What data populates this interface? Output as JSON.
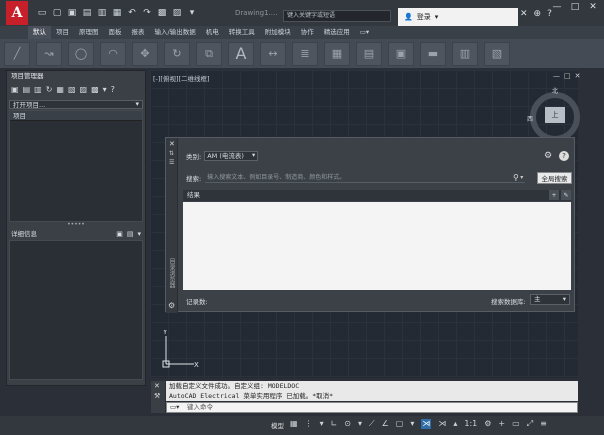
{
  "app": {
    "logo_letter": "A",
    "title": "Drawing1....",
    "search_placeholder": "键入关键字或短语",
    "login_label": "登录",
    "window_controls": [
      "—",
      "□",
      "✕"
    ]
  },
  "ribbon": {
    "tabs": [
      "默认",
      "项目",
      "原理图",
      "面板",
      "报表",
      "输入/输出数据",
      "机电",
      "转换工具",
      "附加模块",
      "协作",
      "精选应用",
      "▭▾"
    ],
    "active_tab_index": 0
  },
  "project_manager": {
    "title": "项目管理器",
    "open_project_label": "打开项目...",
    "tree_header": "项目",
    "details_label": "详细信息",
    "splitter": "•••••"
  },
  "drawing": {
    "view_label": "[-][俯视][二维线框]",
    "compass": {
      "north": "北",
      "west": "西",
      "top": "上"
    },
    "ucs": {
      "x": "X",
      "y": "Y"
    }
  },
  "dialog": {
    "category_label": "类别:",
    "category_value": "AM (电流表)",
    "search_label": "搜索:",
    "search_placeholder": "输入搜索文本、例如目录号、制造商、颜色和样式。",
    "global_search_label": "全局搜索",
    "results_label": "结果",
    "records_label": "记录数:",
    "search_db_label": "搜索数据库:",
    "search_db_value": "主",
    "side_title": "目录浏览器"
  },
  "command": {
    "history_line1": "加载自定义文件成功。自定义组: MODELDOC",
    "history_line2": "AutoCAD Electrical 菜单实用程序 已加载。*取消*",
    "input_placeholder": "键入命令"
  },
  "status": {
    "model_label": "模型",
    "scale_label": "1:1"
  }
}
